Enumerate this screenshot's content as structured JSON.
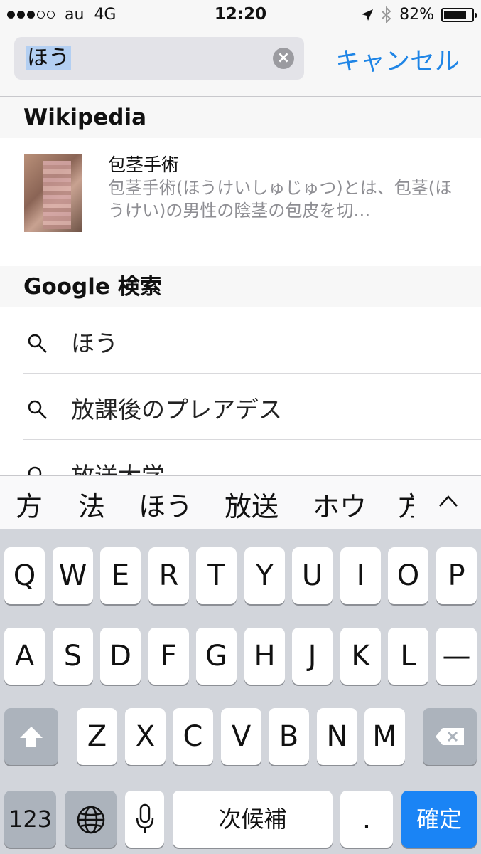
{
  "status_bar": {
    "signal_filled": 3,
    "signal_total": 5,
    "carrier": "au",
    "network": "4G",
    "time": "12:20",
    "battery": "82%",
    "battery_level": 0.82,
    "icons": [
      "location-arrow-icon",
      "bluetooth-icon",
      "battery-icon"
    ]
  },
  "search": {
    "query": "ほう",
    "cancel_label": "キャンセル"
  },
  "sections": {
    "wikipedia_header": "Wikipedia",
    "google_header": "Google 検索"
  },
  "wikipedia_result": {
    "title": "包茎手術",
    "snippet": "包茎手術(ほうけいしゅじゅつ)とは、包茎(ほうけい)の男性の陰茎の包皮を切…"
  },
  "suggestions": [
    "ほう",
    "放課後のプレアデス",
    "放送大学"
  ],
  "candidates": [
    "方",
    "法",
    "ほう",
    "放送",
    "ホウ",
    "方"
  ],
  "keyboard": {
    "row1": [
      "Q",
      "W",
      "E",
      "R",
      "T",
      "Y",
      "U",
      "I",
      "O",
      "P"
    ],
    "row2": [
      "A",
      "S",
      "D",
      "F",
      "G",
      "H",
      "J",
      "K",
      "L",
      "—"
    ],
    "row3": [
      "Z",
      "X",
      "C",
      "V",
      "B",
      "N",
      "M"
    ],
    "numbers_key": "123",
    "space_key": "次候補",
    "period_key": ".",
    "confirm_key": "確定"
  },
  "colors": {
    "accent": "#1f85e6",
    "confirm": "#1a84f5",
    "selection": "#b3cff2"
  }
}
